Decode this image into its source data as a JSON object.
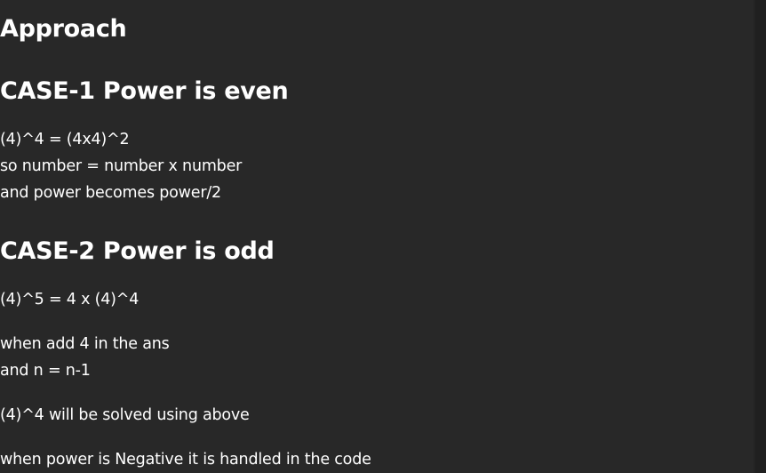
{
  "doc": {
    "title": "Approach",
    "case1": {
      "heading": "CASE-1 Power is even",
      "lines": [
        "(4)^4 = (4x4)^2",
        "so number = number x number",
        "and power becomes power/2"
      ]
    },
    "case2": {
      "heading": "CASE-2 Power is odd",
      "para1": "(4)^5 = 4 x (4)^4",
      "para2_lines": [
        "when add 4 in the ans",
        "and n = n-1"
      ],
      "para3": "(4)^4 will be solved using above",
      "para4": "when power is Negative it is handled in the code"
    }
  }
}
